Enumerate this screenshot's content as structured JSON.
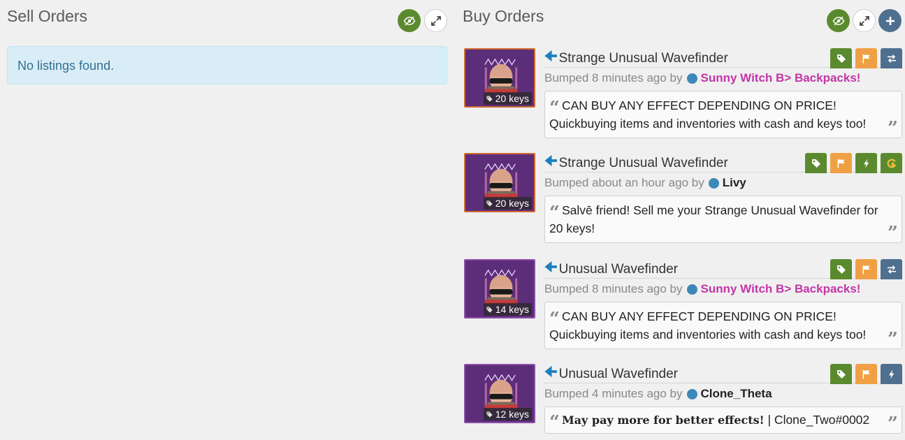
{
  "sell": {
    "title": "Sell Orders",
    "empty_message": "No listings found."
  },
  "buy": {
    "title": "Buy Orders",
    "listings": [
      {
        "name": "Strange Unusual Wavefinder",
        "price": "20 keys",
        "bumped": "Bumped 8 minutes ago by",
        "user": "Sunny Witch B> Backpacks!",
        "message": "CAN BUY ANY EFFECT DEPENDING ON PRICE! Quickbuying items and inventories with cash and keys too!",
        "actions": [
          "tag",
          "flag",
          "trade"
        ]
      },
      {
        "name": "Strange Unusual Wavefinder",
        "price": "20 keys",
        "bumped": "Bumped about an hour ago by",
        "user": "Livy",
        "message": "Salvē friend! Sell me your Strange Unusual Wavefinder for 20 keys!",
        "actions": [
          "tag",
          "flag",
          "lightning",
          "gladiator"
        ]
      },
      {
        "name": "Unusual Wavefinder",
        "price": "14 keys",
        "bumped": "Bumped 8 minutes ago by",
        "user": "Sunny Witch B> Backpacks!",
        "message": "CAN BUY ANY EFFECT DEPENDING ON PRICE! Quickbuying items and inventories with cash and keys too!",
        "actions": [
          "tag",
          "flag",
          "trade"
        ]
      },
      {
        "name": "Unusual Wavefinder",
        "price": "12 keys",
        "bumped": "Bumped 4 minutes ago by",
        "user": "Clone_Theta",
        "message_bold": "May pay more for better effects!",
        "message_rest": " | Clone_Two#0002",
        "actions": [
          "tag",
          "flag",
          "lightning"
        ]
      }
    ]
  },
  "colors": {
    "green": "#5b8a2e",
    "orange": "#f0a044",
    "slate": "#4f6f8f",
    "pink_user": "#c235a6",
    "strange_border": "#cf6a32",
    "unusual_bg": "#5c2d79"
  },
  "icons": {
    "hide": "eye-slash-icon",
    "expand": "expand-icon",
    "add": "plus-icon",
    "tag": "tag-icon",
    "flag": "flag-icon",
    "trade": "exchange-icon",
    "lightning": "lightning-icon",
    "gladiator": "gladiator-icon",
    "quote": "quote-icon"
  }
}
